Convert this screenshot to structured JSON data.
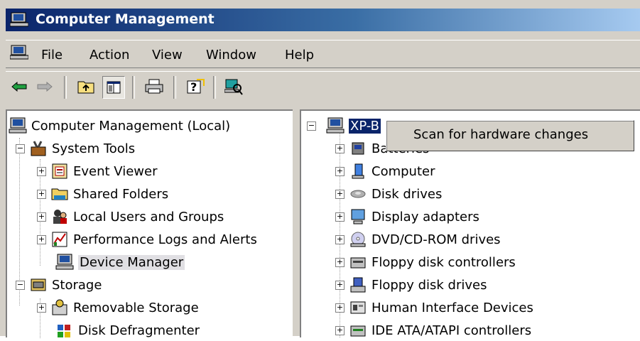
{
  "window": {
    "title": "Computer Management",
    "title_icon": "computer-management-icon"
  },
  "menubar": {
    "items": [
      "File",
      "Action",
      "View",
      "Window",
      "Help"
    ]
  },
  "toolbar": {
    "buttons": [
      "back-arrow-icon",
      "forward-arrow-icon",
      "up-folder-icon",
      "show-hide-tree-icon",
      "print-icon",
      "help-icon",
      "scan-hardware-icon"
    ]
  },
  "left_tree": {
    "items": [
      {
        "label": "Computer Management (Local)",
        "icon": "computer-icon"
      },
      {
        "label": "System Tools",
        "icon": "tools-icon"
      },
      {
        "label": "Event Viewer",
        "icon": "event-viewer-icon"
      },
      {
        "label": "Shared Folders",
        "icon": "shared-folder-icon"
      },
      {
        "label": "Local Users and Groups",
        "icon": "users-icon"
      },
      {
        "label": "Performance Logs and Alerts",
        "icon": "performance-icon"
      },
      {
        "label": "Device Manager",
        "icon": "device-manager-icon"
      },
      {
        "label": "Storage",
        "icon": "storage-icon"
      },
      {
        "label": "Removable Storage",
        "icon": "removable-storage-icon"
      },
      {
        "label": "Disk Defragmenter",
        "icon": "defrag-icon"
      }
    ]
  },
  "right_tree": {
    "root": {
      "label": "XP-B",
      "icon": "computer-icon"
    },
    "items": [
      {
        "label": "Batteries",
        "icon": "battery-icon"
      },
      {
        "label": "Computer",
        "icon": "computer-icon"
      },
      {
        "label": "Disk drives",
        "icon": "disk-drive-icon"
      },
      {
        "label": "Display adapters",
        "icon": "display-adapter-icon"
      },
      {
        "label": "DVD/CD-ROM drives",
        "icon": "cdrom-icon"
      },
      {
        "label": "Floppy disk controllers",
        "icon": "floppy-controller-icon"
      },
      {
        "label": "Floppy disk drives",
        "icon": "floppy-drive-icon"
      },
      {
        "label": "Human Interface Devices",
        "icon": "hid-icon"
      },
      {
        "label": "IDE ATA/ATAPI controllers",
        "icon": "ide-controller-icon"
      }
    ]
  },
  "context_menu": {
    "items": [
      "Scan for hardware changes"
    ]
  },
  "colors": {
    "selection": "#0a246a",
    "chrome": "#d4d0c8"
  }
}
